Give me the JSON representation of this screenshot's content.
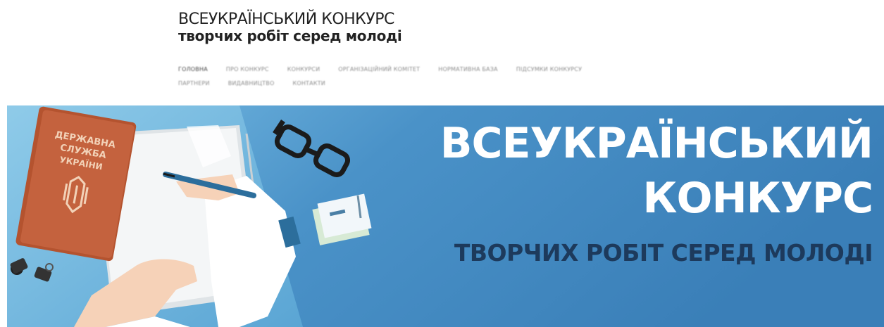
{
  "site": {
    "title_line1": "ВСЕУКРАЇНСЬКИЙ КОНКУРС",
    "title_line2": "творчих робіт серед молоді"
  },
  "nav": {
    "row1": [
      {
        "label": "ГОЛОВНА",
        "current": true
      },
      {
        "label": "ПРО КОНКУРС"
      },
      {
        "label": "КОНКУРСИ"
      },
      {
        "label": "ОРГАНІЗАЦІЙНИЙ КОМІТЕТ"
      },
      {
        "label": "НОРМАТИВНА БАЗА"
      },
      {
        "label": "ПІДСУМКИ КОНКУРСУ"
      }
    ],
    "row2": [
      {
        "label": "ПАРТНЕРИ"
      },
      {
        "label": "ВИДАВНИЦТВО"
      },
      {
        "label": "КОНТАКТИ"
      }
    ]
  },
  "banner": {
    "heading_line1": "ВСЕУКРАЇНСЬКИЙ",
    "heading_line2": "КОНКУРС",
    "subheading": "ТВОРЧИХ РОБІТ СЕРЕД МОЛОДІ",
    "book_label": "ДЕРЖАВНА СЛУЖБА УКРАЇНИ",
    "colors": {
      "sky": "#4a92c8",
      "panel_light": "#6fb3dd",
      "paper": "#f4f6f7",
      "book": "#c4623e",
      "sleeve": "#ffffff",
      "skin": "#f6d2b8",
      "pen": "#2c6e9c",
      "subheading": "#1d3a5c"
    }
  }
}
